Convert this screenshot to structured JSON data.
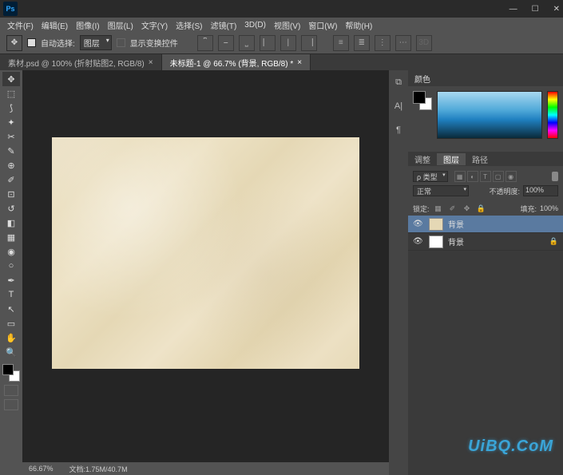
{
  "titlebar": {
    "logo": "Ps"
  },
  "menu": [
    "文件(F)",
    "编辑(E)",
    "图像(I)",
    "图层(L)",
    "文字(Y)",
    "选择(S)",
    "滤镜(T)",
    "3D(D)",
    "视图(V)",
    "窗口(W)",
    "帮助(H)"
  ],
  "options": {
    "auto_select": "自动选择:",
    "group": "图层",
    "show_transform": "显示变换控件"
  },
  "tabs": [
    {
      "label": "素材.psd @ 100% (折射贴图2, RGB/8)",
      "active": false
    },
    {
      "label": "未标题-1 @ 66.7% (背景, RGB/8) *",
      "active": true
    }
  ],
  "status": {
    "zoom": "66.67%",
    "docinfo": "文档:1.75M/40.7M"
  },
  "panels": {
    "color_tab": "颜色",
    "layers_tabs": [
      "调整",
      "图层",
      "路径"
    ],
    "layers_active": "图层",
    "kind": "ρ 类型",
    "blend_mode": "正常",
    "opacity_label": "不透明度:",
    "opacity_value": "100%",
    "lock_label": "锁定:",
    "fill_label": "填充:",
    "fill_value": "100%",
    "layers": [
      {
        "name": "背景",
        "selected": true,
        "thumb": "#e5d8b5",
        "locked": false
      },
      {
        "name": "背景",
        "selected": false,
        "thumb": "#ffffff",
        "locked": true
      }
    ]
  },
  "watermark": "UiBQ.CoM"
}
